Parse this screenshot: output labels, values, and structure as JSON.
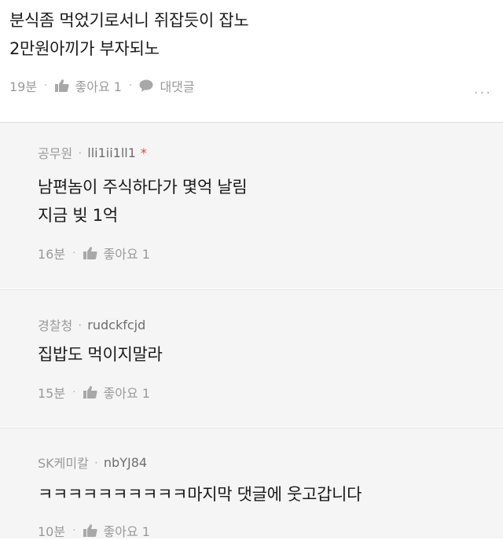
{
  "top_comment": {
    "lines": [
      "분식좀 먹었기로서니 쥐잡듯이 잡노",
      "2만원아끼가 부자되노"
    ],
    "time": "19분",
    "like_label": "좋아요 1",
    "reply_label": "대댓글",
    "more": "···"
  },
  "replies": [
    {
      "org": "공무원",
      "nick": "lli1ii1ll1",
      "badge": "*",
      "lines": [
        "남편놈이 주식하다가 몇억 날림",
        "지금 빚 1억"
      ],
      "time": "16분",
      "like_label": "좋아요 1"
    },
    {
      "org": "경찰청",
      "nick": "rudckfcjd",
      "lines": [
        "집밥도 먹이지말라"
      ],
      "time": "15분",
      "like_label": "좋아요 1"
    },
    {
      "org": "SK케미칼",
      "nick": "nbYJ84",
      "lines": [
        "ㅋㅋㅋㅋㅋㅋㅋㅋㅋㅋ마지막 댓글에 웃고갑니다"
      ],
      "time": "10분",
      "like_label": "좋아요 1"
    }
  ],
  "colors": {
    "text": "#1a1a1a",
    "meta": "#9a9a9a",
    "reply_bg": "#f5f5f5",
    "badge": "#e0473f"
  }
}
